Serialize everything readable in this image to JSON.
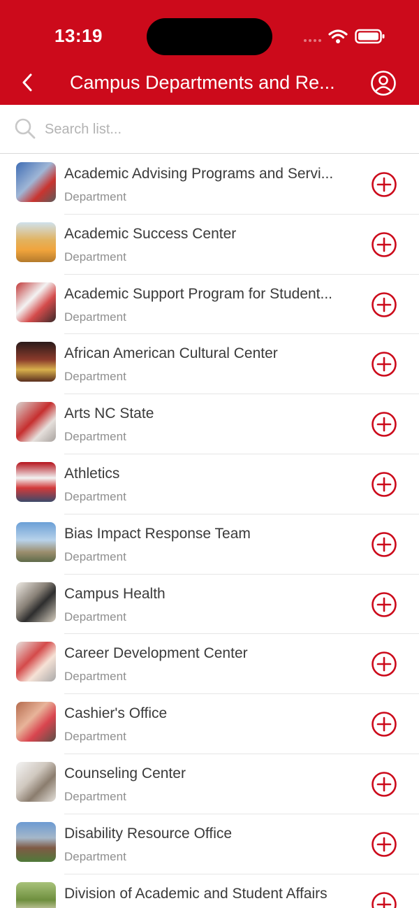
{
  "status_bar": {
    "time": "13:19"
  },
  "nav": {
    "title": "Campus Departments and Re...",
    "back_icon": "chevron-left-icon",
    "profile_icon": "user-circle-icon"
  },
  "search": {
    "placeholder": "Search list...",
    "value": ""
  },
  "colors": {
    "brand_red": "#cc0a1b",
    "text": "#3a3a3a",
    "subtext": "#8f8f8f"
  },
  "items": [
    {
      "title": "Academic Advising Programs and Servi...",
      "subtitle": "Department"
    },
    {
      "title": "Academic Success Center",
      "subtitle": "Department"
    },
    {
      "title": "Academic Support Program for Student...",
      "subtitle": "Department"
    },
    {
      "title": "African American Cultural Center",
      "subtitle": "Department"
    },
    {
      "title": "Arts NC State",
      "subtitle": "Department"
    },
    {
      "title": "Athletics",
      "subtitle": "Department"
    },
    {
      "title": "Bias Impact Response Team",
      "subtitle": "Department"
    },
    {
      "title": "Campus Health",
      "subtitle": "Department"
    },
    {
      "title": "Career Development Center",
      "subtitle": "Department"
    },
    {
      "title": "Cashier's Office",
      "subtitle": "Department"
    },
    {
      "title": "Counseling Center",
      "subtitle": "Department"
    },
    {
      "title": "Disability Resource Office",
      "subtitle": "Department"
    },
    {
      "title": "Division of Academic and Student Affairs",
      "subtitle": ""
    }
  ]
}
